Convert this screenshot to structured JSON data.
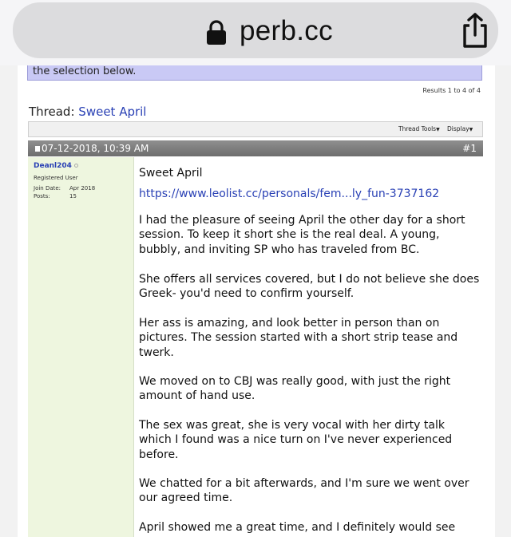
{
  "browser": {
    "url": "perb.cc",
    "lock_icon": "lock-icon",
    "share_icon": "share-icon"
  },
  "notice": {
    "text": "the selection below."
  },
  "results": {
    "text": "Results 1 to 4 of 4"
  },
  "thread": {
    "label": "Thread:",
    "title": "Sweet April"
  },
  "toolbar": {
    "thread_tools": "Thread Tools",
    "display": "Display"
  },
  "post": {
    "date": "07-12-2018, 10:39 AM",
    "number": "#1",
    "user": {
      "name": "Deanl204",
      "title": "Registered User",
      "join_label": "Join Date:",
      "join_value": "Apr 2018",
      "posts_label": "Posts:",
      "posts_value": "15"
    },
    "title": "Sweet April",
    "link": "https://www.leolist.cc/personals/fem...ly_fun-3737162",
    "paragraphs": [
      "I had the pleasure of seeing April the other day for a short session. To keep it short she is the real deal. A young, bubbly, and inviting SP who has traveled from BC.",
      "She offers all services covered, but I do not believe she does Greek- you'd need to confirm yourself.",
      "Her ass is amazing, and look better in person than on pictures. The session started with a short strip tease and twerk.",
      "We moved on to CBJ was really good, with just the right amount of hand use.",
      "The sex was great, she is very vocal with her dirty talk which I found was a nice turn on I've never experienced before.",
      "We chatted for a bit afterwards, and I'm sure we went over our agreed time.",
      "April showed me a great time, and I definitely would see"
    ]
  }
}
